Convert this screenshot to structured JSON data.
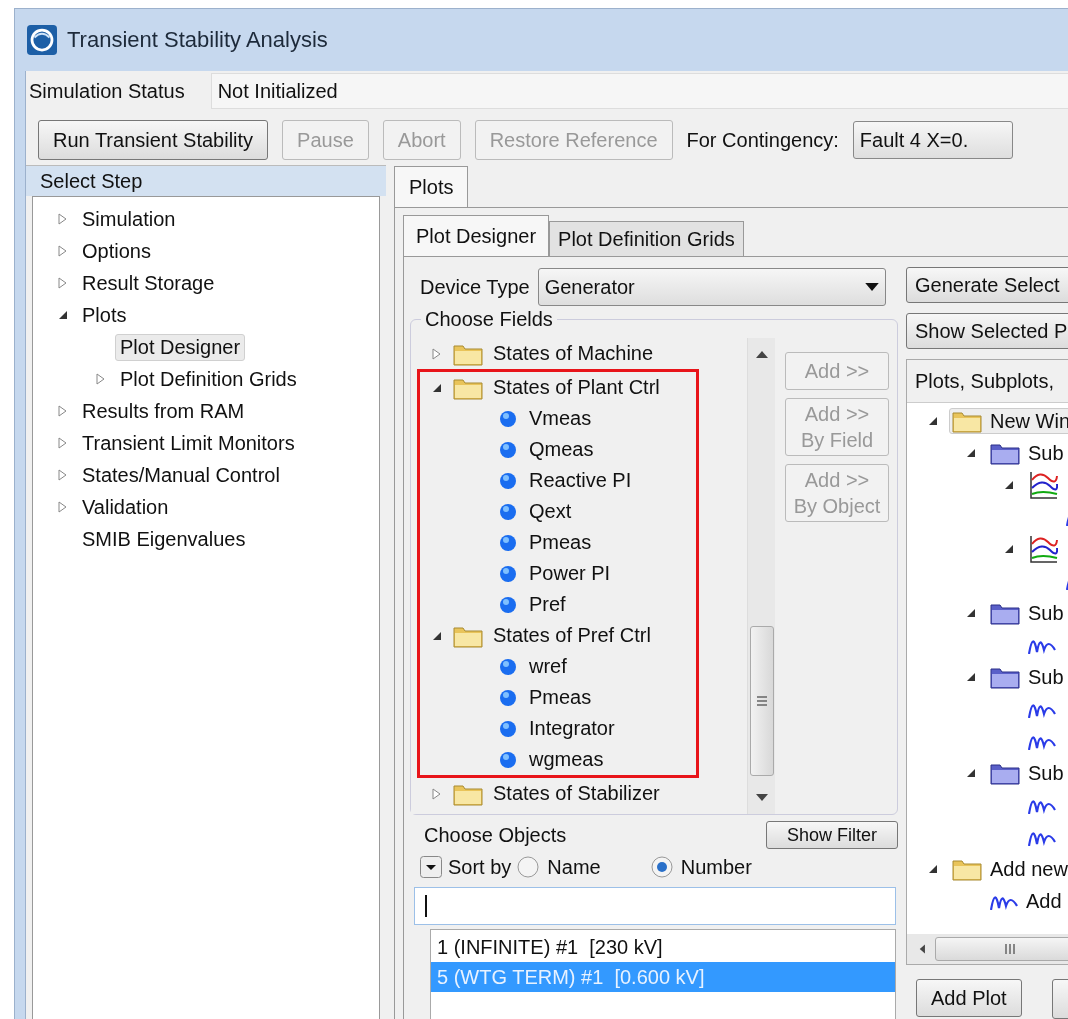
{
  "window": {
    "title": "Transient Stability Analysis"
  },
  "status": {
    "label": "Simulation Status",
    "value": "Not Initialized"
  },
  "toolbar": {
    "buttons": [
      {
        "label": "Run Transient Stability",
        "disabled": false
      },
      {
        "label": "Pause",
        "disabled": true
      },
      {
        "label": "Abort",
        "disabled": true
      },
      {
        "label": "Restore Reference",
        "disabled": true
      }
    ],
    "contingency_label": "For Contingency:",
    "contingency_value": "Fault 4 X=0."
  },
  "steps": {
    "title": "Select Step",
    "items": [
      {
        "label": "Simulation",
        "kind": "branch",
        "expanded": false,
        "selected": false
      },
      {
        "label": "Options",
        "kind": "branch",
        "expanded": false,
        "selected": false
      },
      {
        "label": "Result Storage",
        "kind": "branch",
        "expanded": false,
        "selected": false
      },
      {
        "label": "Plots",
        "kind": "branch",
        "expanded": true,
        "selected": false,
        "children": [
          {
            "label": "Plot Designer",
            "kind": "leaf",
            "selected": true
          },
          {
            "label": "Plot Definition Grids",
            "kind": "branch",
            "expanded": false,
            "selected": false
          }
        ]
      },
      {
        "label": "Results from RAM",
        "kind": "branch",
        "expanded": false,
        "selected": false
      },
      {
        "label": "Transient Limit Monitors",
        "kind": "branch",
        "expanded": false,
        "selected": false
      },
      {
        "label": "States/Manual Control",
        "kind": "branch",
        "expanded": false,
        "selected": false
      },
      {
        "label": "Validation",
        "kind": "branch",
        "expanded": false,
        "selected": false
      },
      {
        "label": "SMIB Eigenvalues",
        "kind": "leaf",
        "selected": false
      }
    ]
  },
  "tabs": [
    {
      "label": "Plots",
      "selected": true
    }
  ],
  "subtabs": [
    {
      "label": "Plot Designer",
      "selected": true
    },
    {
      "label": "Plot Definition Grids",
      "selected": false
    }
  ],
  "device_type": {
    "label": "Device Type",
    "value": "Generator"
  },
  "fields": {
    "title": "Choose Fields",
    "items": [
      {
        "label": "States of Machine",
        "expanded": false,
        "highlighted": false
      },
      {
        "label": "States of Plant Ctrl",
        "expanded": true,
        "highlighted": true,
        "children": [
          {
            "label": "Vmeas"
          },
          {
            "label": "Qmeas"
          },
          {
            "label": "Reactive PI"
          },
          {
            "label": "Qext"
          },
          {
            "label": "Pmeas"
          },
          {
            "label": "Power PI"
          },
          {
            "label": "Pref"
          }
        ]
      },
      {
        "label": "States of Pref Ctrl",
        "expanded": true,
        "highlighted": true,
        "children": [
          {
            "label": "wref"
          },
          {
            "label": "Pmeas"
          },
          {
            "label": "Integrator"
          },
          {
            "label": "wgmeas"
          }
        ]
      },
      {
        "label": "States of Stabilizer",
        "expanded": false,
        "highlighted": false
      }
    ]
  },
  "add_buttons": [
    {
      "lines": [
        "Add >>"
      ],
      "disabled": true
    },
    {
      "lines": [
        "Add >>",
        "By Field"
      ],
      "disabled": true
    },
    {
      "lines": [
        "Add >>",
        "By Object"
      ],
      "disabled": true
    }
  ],
  "objects": {
    "title": "Choose Objects",
    "filter_button": "Show Filter",
    "sort_label": "Sort by",
    "sort_options": [
      {
        "label": "Name",
        "selected": false
      },
      {
        "label": "Number",
        "selected": true
      }
    ],
    "list": [
      {
        "label": "1 (INFINITE) #1  [230 kV]",
        "selected": false
      },
      {
        "label": "5 (WTG TERM) #1  [0.600 kV]",
        "selected": true
      }
    ]
  },
  "plots_panel": {
    "buttons": [
      "Generate Select",
      "Show Selected P"
    ],
    "tree_title": "Plots, Subplots,",
    "tree": [
      {
        "kind": "window",
        "label": "New Win",
        "expanded": true,
        "selected": true,
        "children": [
          {
            "kind": "subplot",
            "label": "Sub",
            "expanded": true,
            "selected": false,
            "children": [
              {
                "kind": "plot",
                "expanded": true,
                "selected": false,
                "children": [
                  {
                    "kind": "curve",
                    "selected": false
                  }
                ]
              },
              {
                "kind": "plot",
                "expanded": true,
                "selected": false,
                "children": [
                  {
                    "kind": "curve",
                    "selected": false
                  }
                ]
              }
            ]
          },
          {
            "kind": "subplot",
            "label": "Sub",
            "expanded": true,
            "selected": false,
            "children": [
              {
                "kind": "curve",
                "selected": false
              }
            ]
          },
          {
            "kind": "subplot",
            "label": "Sub",
            "expanded": true,
            "selected": false,
            "children": [
              {
                "kind": "curve",
                "selected": false
              },
              {
                "kind": "curve",
                "selected": false
              }
            ]
          },
          {
            "kind": "subplot",
            "label": "Sub",
            "expanded": true,
            "selected": false,
            "children": [
              {
                "kind": "curve",
                "selected": false
              },
              {
                "kind": "curve",
                "selected": false
              }
            ]
          }
        ]
      },
      {
        "kind": "window",
        "label": "Add new",
        "expanded": true,
        "selected": false,
        "children": [
          {
            "kind": "curve",
            "label": "Add",
            "selected": false
          }
        ]
      }
    ],
    "bottom_buttons": [
      "Add Plot"
    ]
  }
}
